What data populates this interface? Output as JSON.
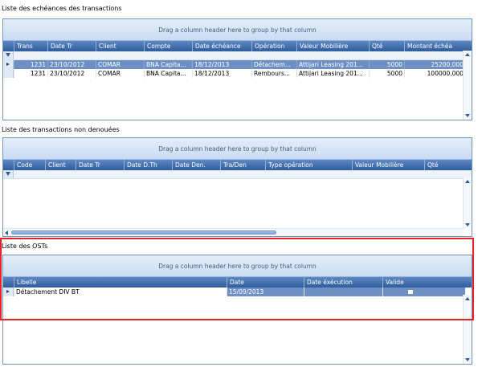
{
  "group_hint": "Drag a column header here to group by that column",
  "echeances": {
    "title": "Liste des echéances des transactions",
    "columns": [
      "Trans",
      "Date Tr",
      "Client",
      "Compte",
      "Date échéance",
      "Opération",
      "Valeur Mobilière",
      "Qté",
      "Montant échéa"
    ],
    "rows": [
      [
        "1231",
        "23/10/2012",
        "COMAR",
        "BNA Capita...",
        "18/12/2013",
        "Détachem...",
        "Attijari Leasing 201...",
        "5000",
        "25200,000"
      ],
      [
        "1231",
        "23/10/2012",
        "COMAR",
        "BNA Capita...",
        "18/12/2013",
        "Rembours...",
        "Attijari Leasing 201...",
        "5000",
        "100000,000"
      ]
    ]
  },
  "non_denouees": {
    "title": "Liste des transactions non denouées",
    "columns": [
      "Code",
      "Client",
      "Date Tr",
      "Date D.Th",
      "Date Den.",
      "Tra/Den",
      "Type opération",
      "Valeur Mobilière",
      "Qté"
    ]
  },
  "osts": {
    "title": "Liste des OSTs",
    "columns": [
      "Libelle",
      "Date",
      "Date éxécution",
      "Valide"
    ],
    "rows": [
      [
        "Détachement DIV BT",
        "15/09/2013",
        "",
        ""
      ]
    ]
  },
  "colors": {
    "header": "#2e5c9c",
    "selection": "#6d8fc4",
    "highlight_box": "#e8202a"
  }
}
